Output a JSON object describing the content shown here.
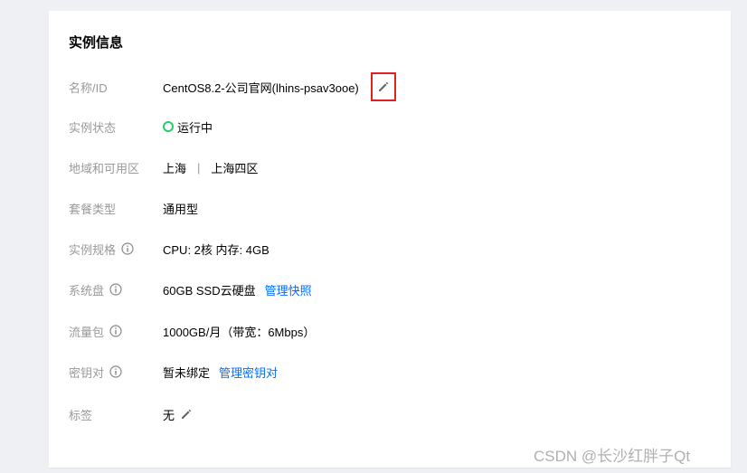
{
  "card": {
    "title": "实例信息",
    "rows": [
      {
        "label": "名称/ID",
        "value": "CentOS8.2-公司官网(lhins-psav3ooe)"
      },
      {
        "label": "实例状态",
        "value": "运行中"
      },
      {
        "label": "地域和可用区",
        "region": "上海",
        "separator": "|",
        "zone": "上海四区"
      },
      {
        "label": "套餐类型",
        "value": "通用型"
      },
      {
        "label": "实例规格",
        "value": "CPU: 2核 内存: 4GB"
      },
      {
        "label": "系统盘",
        "value": "60GB SSD云硬盘",
        "link": "管理快照"
      },
      {
        "label": "流量包",
        "value": "1000GB/月（带宽：6Mbps）"
      },
      {
        "label": "密钥对",
        "value": "暂未绑定",
        "link": "管理密钥对"
      },
      {
        "label": "标签",
        "value": "无"
      }
    ]
  },
  "watermark": "CSDN @长沙红胖子Qt",
  "colors": {
    "status_running": "#29cc6a",
    "link": "#006eff",
    "highlight_box": "#e02020"
  }
}
